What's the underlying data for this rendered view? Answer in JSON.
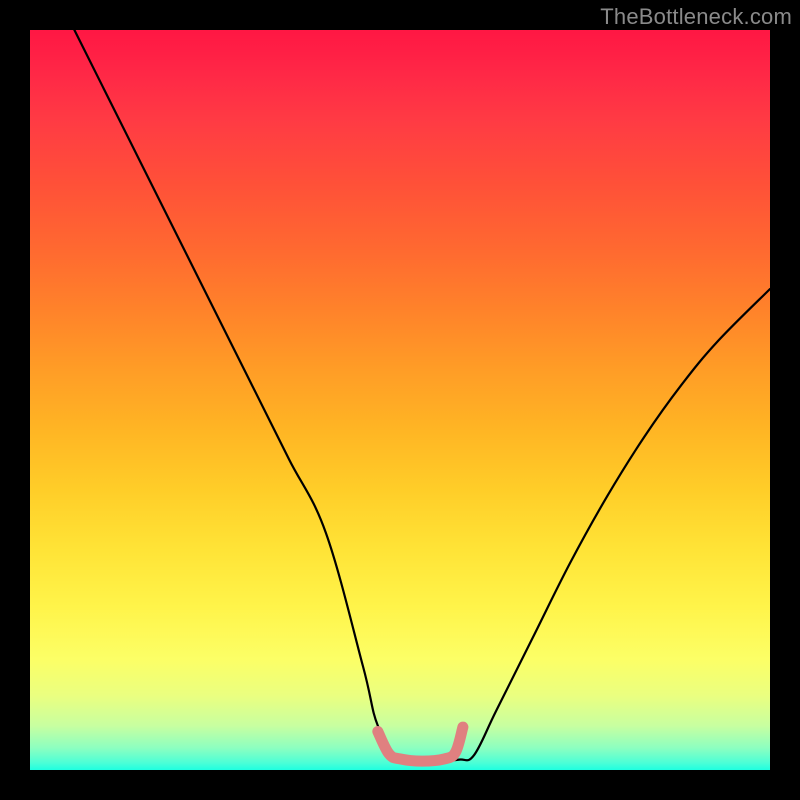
{
  "watermark": "TheBottleneck.com",
  "chart_data": {
    "type": "line",
    "title": "",
    "xlabel": "",
    "ylabel": "",
    "xlim": [
      0,
      100
    ],
    "ylim": [
      0,
      100
    ],
    "grid": false,
    "legend": false,
    "series": [
      {
        "name": "bottleneck-curve",
        "color": "#000000",
        "x": [
          6,
          10,
          15,
          20,
          25,
          30,
          35,
          40,
          45,
          47,
          50,
          53,
          55,
          58,
          60,
          63,
          68,
          73,
          78,
          83,
          88,
          93,
          100
        ],
        "y": [
          100,
          92,
          82,
          72,
          62,
          52,
          42,
          32,
          14,
          6,
          1.5,
          1.2,
          1.2,
          1.4,
          2,
          8,
          18,
          28,
          37,
          45,
          52,
          58,
          65
        ]
      },
      {
        "name": "optimal-zone-marker",
        "color": "#e57373",
        "x": [
          47,
          48.5,
          50,
          53,
          56,
          57.5,
          58.5
        ],
        "y": [
          5.2,
          2.2,
          1.5,
          1.2,
          1.5,
          2.4,
          5.8
        ]
      }
    ],
    "colormap": {
      "type": "vertical-gradient",
      "stops": [
        {
          "pos": 0.0,
          "color": "#ff1744"
        },
        {
          "pos": 0.21,
          "color": "#ff5138"
        },
        {
          "pos": 0.46,
          "color": "#ff9d26"
        },
        {
          "pos": 0.7,
          "color": "#ffe336"
        },
        {
          "pos": 0.9,
          "color": "#eaff80"
        },
        {
          "pos": 1.0,
          "color": "#1fffe0"
        }
      ]
    }
  }
}
